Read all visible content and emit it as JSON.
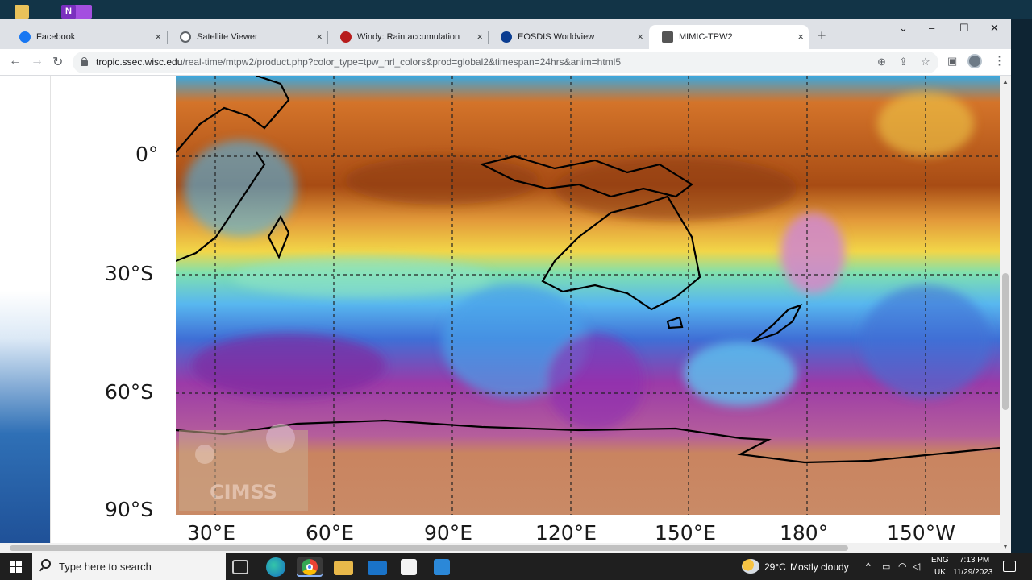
{
  "desktop": {
    "icons": [
      "folder-icon",
      "onenote-icon"
    ],
    "onenote_letter": "N"
  },
  "browser": {
    "tabs": [
      {
        "title": "Facebook",
        "favicon": "facebook-icon",
        "color": "#1877f2"
      },
      {
        "title": "Satellite Viewer",
        "favicon": "globe-icon",
        "color": "#5f6368"
      },
      {
        "title": "Windy: Rain accumulation",
        "favicon": "windy-icon",
        "color": "#b71c1c"
      },
      {
        "title": "EOSDIS Worldview",
        "favicon": "nasa-icon",
        "color": "#0b3d91"
      },
      {
        "title": "MIMIC-TPW2",
        "favicon": "mimic-icon",
        "color": "#555555"
      }
    ],
    "active_tab_index": 4,
    "close_glyph": "×",
    "new_tab_glyph": "+",
    "window_controls": {
      "minimize": "–",
      "maximize": "☐",
      "close": "✕",
      "tab_search": "⌄"
    },
    "nav": {
      "back": "←",
      "forward": "→",
      "reload": "↻"
    },
    "url_host": "tropic.ssec.wisc.edu",
    "url_path": "/real-time/mtpw2/product.php?color_type=tpw_nrl_colors&prod=global2&timespan=24hrs&anim=html5",
    "omnibox_icons": {
      "zoom": "⊕",
      "share": "⇪",
      "bookmark": "☆"
    },
    "toolbar_icons": {
      "sidepanel": "▣",
      "menu": "⋮"
    }
  },
  "page": {
    "latitude_labels": [
      "0°",
      "30°S",
      "60°S",
      "90°S"
    ],
    "longitude_labels": [
      "30°E",
      "60°E",
      "90°E",
      "120°E",
      "150°E",
      "180°",
      "150°W"
    ],
    "watermark": "CIMSS"
  },
  "taskbar": {
    "search_placeholder": "Type here to search",
    "weather_temp": "29°C",
    "weather_text": "Mostly cloudy",
    "language": "ENG",
    "region": "UK",
    "time": "7:13 PM",
    "date": "11/29/2023",
    "tray_chevron": "^"
  }
}
